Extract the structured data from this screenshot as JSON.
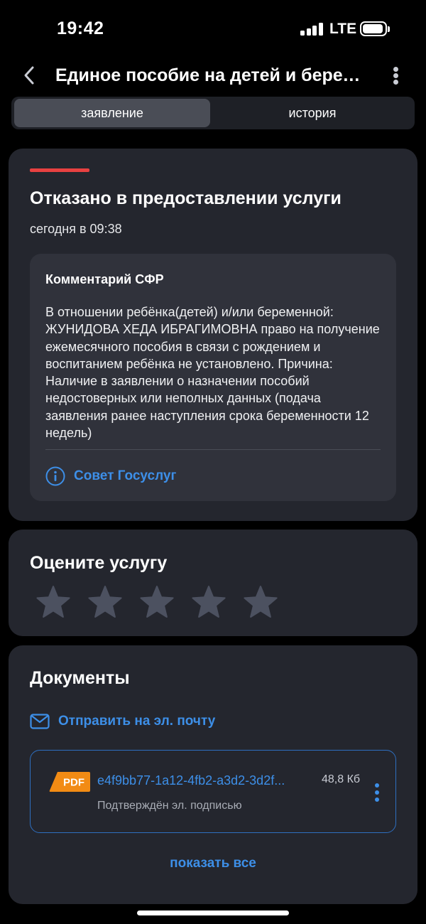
{
  "status_bar": {
    "time": "19:42",
    "network": "LTE",
    "signal_bars": 4,
    "battery_level": 0.8
  },
  "header": {
    "title": "Единое пособие на детей и берем...",
    "back_icon": "chevron-left-icon",
    "menu_icon": "more-vertical-icon"
  },
  "tabs": [
    {
      "label": "заявление",
      "active": true
    },
    {
      "label": "история",
      "active": false
    }
  ],
  "status_card": {
    "title": "Отказано в предоставлении услуги",
    "time": "сегодня в 09:38",
    "status_color": "#e84141",
    "comment": {
      "title": "Комментарий СФР",
      "text": "В отношении ребёнка(детей) и/или беременной: ЖУНИДОВА ХЕДА ИБРАГИМОВНА право на получение ежемесячного пособия в связи с рождением и воспитанием ребёнка не установлено. Причина: Наличие в заявлении о назначении пособий недостоверных или неполных данных (подача заявления ранее наступления срока беременности 12 недель)",
      "advice_label": "Совет Госуслуг",
      "advice_icon": "info-icon"
    }
  },
  "rating": {
    "title": "Оцените услугу",
    "max_stars": 5,
    "selected_stars": 0
  },
  "documents": {
    "title": "Документы",
    "email_label": "Отправить на эл. почту",
    "email_icon": "mail-icon",
    "items": [
      {
        "badge": "PDF",
        "name": "e4f9bb77-1a12-4fb2-a3d2-3d2f...",
        "size": "48,8 Кб",
        "subtitle": "Подтверждён эл. подписью"
      }
    ],
    "show_all_label": "показать все"
  },
  "colors": {
    "background": "#000000",
    "card": "#24262e",
    "accent": "#3d8fe8",
    "danger": "#e84141"
  }
}
